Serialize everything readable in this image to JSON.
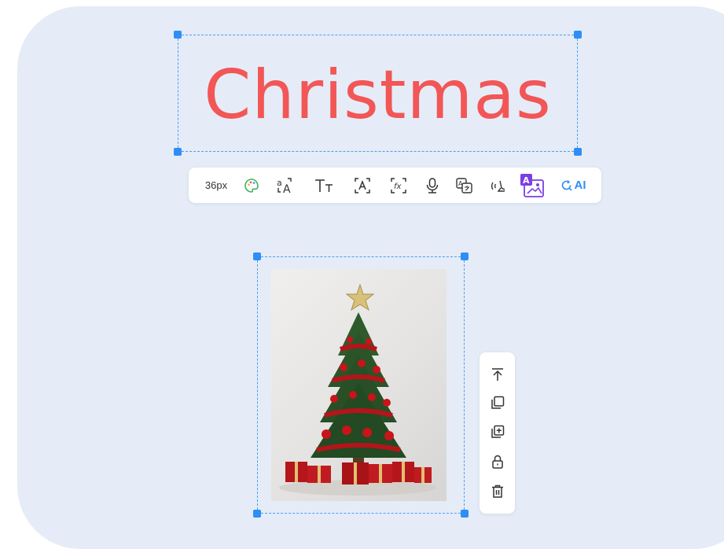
{
  "title_element": {
    "text": "Christmas",
    "color": "#f25656"
  },
  "text_toolbar": {
    "font_size": "36px",
    "items": [
      "palette-icon",
      "font-case-icon",
      "text-size-icon",
      "text-frame-icon",
      "function-icon",
      "microphone-icon",
      "translate-icon",
      "voice-wave-icon",
      "text-to-image-icon"
    ],
    "ai_label": "AI"
  },
  "image_element": {
    "subject": "Christmas tree with ornaments, star topper and wrapped gifts"
  },
  "side_toolbar": {
    "items": [
      "bring-to-front-icon",
      "duplicate-icon",
      "add-page-icon",
      "lock-icon",
      "delete-icon"
    ]
  },
  "colors": {
    "selection": "#2f8ef5",
    "canvas": "#e5ecf7",
    "accent_purple": "#7b3fe4"
  }
}
